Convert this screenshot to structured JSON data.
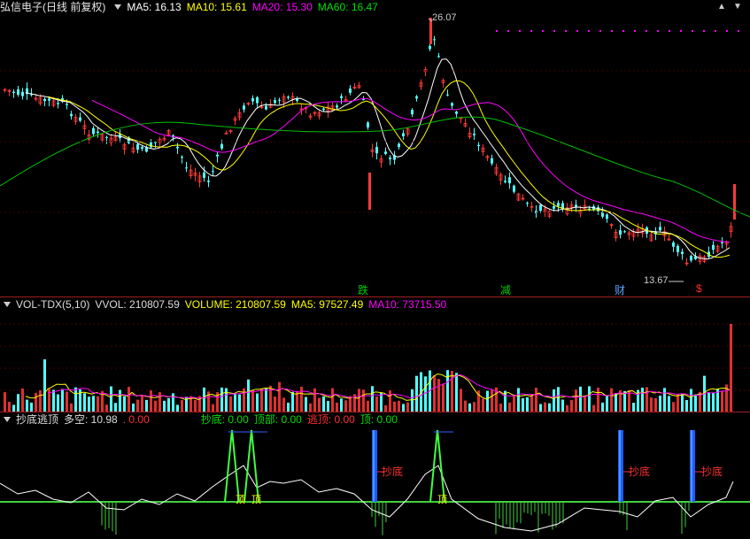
{
  "header": {
    "stock_name": "弘信电子(日线 前复权)",
    "ma5_label": "MA5: 16.13",
    "ma10_label": "MA10: 15.61",
    "ma20_label": "MA20: 15.30",
    "ma60_label": "MA60: 16.47"
  },
  "price_chart": {
    "high_marker": "26.07",
    "low_marker": "13.67",
    "events": [
      "跌",
      "减",
      "财",
      "$"
    ],
    "colors": {
      "up": "#ff3a3a",
      "down": "#54ffff",
      "ma5": "#ffffff",
      "ma10": "#ffff00",
      "ma20": "#ff00ff",
      "ma60": "#00c000"
    }
  },
  "volume_panel": {
    "title": "VOL-TDX(5,10)",
    "vvol_label": "VVOL: 210807.59",
    "volume_label": "VOLUME: 210807.59",
    "ma5_label": "MA5: 97527.49",
    "ma10_label": "MA10: 73715.50"
  },
  "indicator_panel": {
    "title": "抄底逃顶",
    "duokong_label": "多空: 10.98",
    "dot_value": ". 0.00",
    "chaodi_label": "抄底: 0.00",
    "dingbu_label": "顶部: 0.00",
    "taoding_label": "逃顶: 0.00",
    "ding_label": "顶: 0.00",
    "buy_signal_text": "抄底",
    "top_signal_text": "顶"
  },
  "controls": {
    "up_arrow": "▲",
    "down_arrow": "▼"
  }
}
